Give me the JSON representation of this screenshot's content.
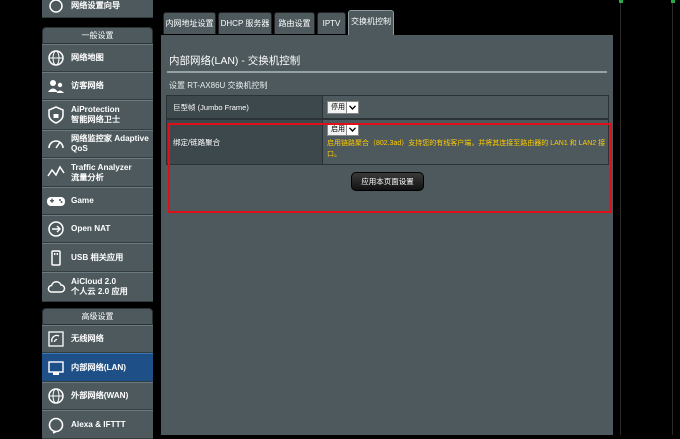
{
  "sidebar": {
    "top_item": "网络设置向导",
    "general_header": "一般设置",
    "general_items": [
      {
        "label": "网络地图",
        "icon": "globe-icon"
      },
      {
        "label": "访客网络",
        "icon": "guest-network-icon"
      },
      {
        "label": "AiProtection\n智能网络卫士",
        "icon": "shield-lock-icon"
      },
      {
        "label": "网络监控家 Adaptive\nQoS",
        "icon": "gauge-icon"
      },
      {
        "label": "Traffic Analyzer\n流量分析",
        "icon": "traffic-analyzer-icon"
      },
      {
        "label": "Game",
        "icon": "gamepad-icon"
      },
      {
        "label": "Open NAT",
        "icon": "open-nat-icon"
      },
      {
        "label": "USB 相关应用",
        "icon": "usb-icon"
      },
      {
        "label": "AiCloud 2.0\n个人云 2.0 应用",
        "icon": "cloud-icon"
      }
    ],
    "advanced_header": "高级设置",
    "advanced_items": [
      {
        "label": "无线网络",
        "icon": "wireless-icon"
      },
      {
        "label": "内部网络(LAN)",
        "icon": "lan-icon",
        "active": true
      },
      {
        "label": "外部网络(WAN)",
        "icon": "wan-globe-icon"
      },
      {
        "label": "Alexa & IFTTT",
        "icon": "alexa-icon"
      }
    ]
  },
  "tabs": [
    "内网地址设置",
    "DHCP 服务器",
    "路由设置",
    "IPTV",
    "交换机控制"
  ],
  "active_tab": "交换机控制",
  "page": {
    "title": "内部网络(LAN) - 交换机控制",
    "subtitle": "设置 RT-AX86U 交换机控制"
  },
  "settings": [
    {
      "label": "巨型帧 (Jumbo Frame)",
      "value": "停用"
    },
    {
      "label": "绑定/链路聚合",
      "value": "启用",
      "hint": "启用链路聚合（802.3ad）支持您的有线客户端，并将其连接至路由器的 LAN1 和 LAN2 接口。"
    }
  ],
  "apply_button": "应用本页面设置",
  "colors": {
    "accent_highlight": "#e0101a",
    "active_menu": "#1e4f87",
    "hint_text": "#ffcc00",
    "panel_bg": "#4d595d"
  }
}
